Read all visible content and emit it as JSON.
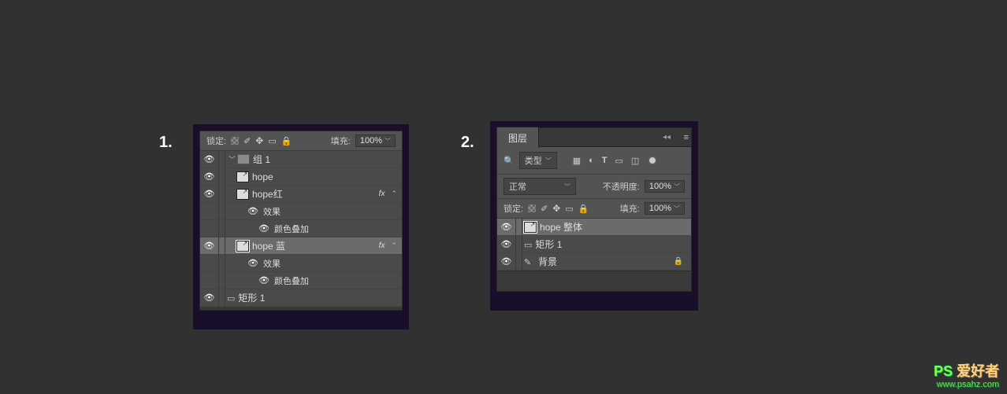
{
  "labels": {
    "one": "1.",
    "two": "2."
  },
  "panel1": {
    "lockRow": {
      "label": "锁定:",
      "fillLabel": "填充:",
      "fillValue": "100%"
    },
    "layers": {
      "group": {
        "name": "组 1"
      },
      "hope": {
        "name": "hope"
      },
      "hopeRed": {
        "name": "hope红",
        "fx": "fx"
      },
      "effects": "效果",
      "colorOverlay": "颜色叠加",
      "hopeBlue": {
        "name": "hope 蓝",
        "fx": "fx"
      },
      "rect": {
        "name": "矩形 1"
      }
    }
  },
  "panel2": {
    "tab": "图层",
    "filter": {
      "kindLabel": "类型"
    },
    "blendRow": {
      "mode": "正常",
      "opacityLabel": "不透明度:",
      "opacityValue": "100%"
    },
    "lockRow": {
      "label": "锁定:",
      "fillLabel": "填充:",
      "fillValue": "100%"
    },
    "layers": {
      "hopeWhole": "hope 整体",
      "rect": "矩形 1",
      "bg": "背景"
    }
  },
  "watermark": {
    "brand_en": "PS",
    "brand_cn": "爱好者",
    "url": "www.psahz.com"
  }
}
